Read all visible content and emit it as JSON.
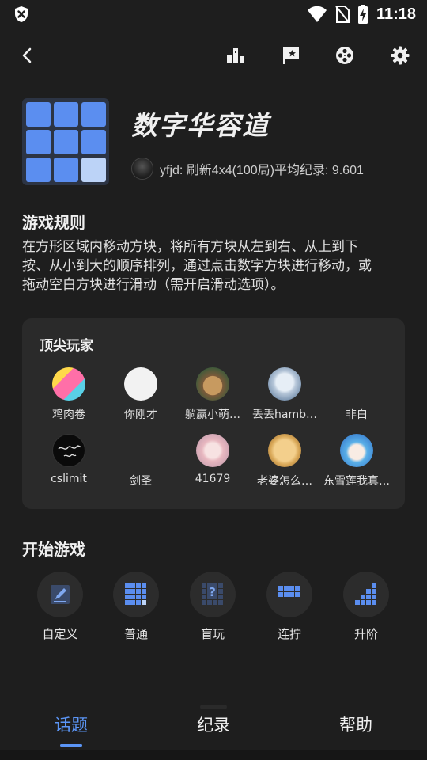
{
  "status_bar": {
    "time": "11:18"
  },
  "app_bar": {
    "icons": [
      "back-icon",
      "leaderboard-icon",
      "flag-icon",
      "film-reel-icon",
      "settings-icon"
    ]
  },
  "header": {
    "title": "数字华容道",
    "record": "yfjd: 刷新4x4(100局)平均纪录: 9.601"
  },
  "rules": {
    "heading": "游戏规则",
    "lines": [
      "在方形区域内移动方块，将所有方块从左到右、从上到下",
      "按、从小到大的顺序排列，通过点击数字方块进行移动，或",
      "拖动空白方块进行滑动（需开启滑动选项）。"
    ]
  },
  "top_players": {
    "heading": "顶尖玩家",
    "players": [
      {
        "name": "鸡肉卷"
      },
      {
        "name": "你刚才"
      },
      {
        "name": "躺赢小萌…"
      },
      {
        "name": "丢丢hamb…"
      },
      {
        "name": "非白"
      },
      {
        "name": "cslimit"
      },
      {
        "name": "剑圣"
      },
      {
        "name": "41679"
      },
      {
        "name": "老婆怎么…"
      },
      {
        "name": "东雪莲我真…"
      }
    ]
  },
  "start_game": {
    "heading": "开始游戏",
    "modes": [
      {
        "label": "自定义"
      },
      {
        "label": "普通"
      },
      {
        "label": "盲玩"
      },
      {
        "label": "连拧"
      },
      {
        "label": "升阶"
      }
    ]
  },
  "tabs": [
    {
      "label": "话题",
      "active": true
    },
    {
      "label": "纪录",
      "active": false
    },
    {
      "label": "帮助",
      "active": false
    }
  ],
  "colors": {
    "accent": "#5b95f5",
    "tile": "#5b8ef0",
    "background": "#1e1e1e",
    "card": "#2a2a2a"
  }
}
